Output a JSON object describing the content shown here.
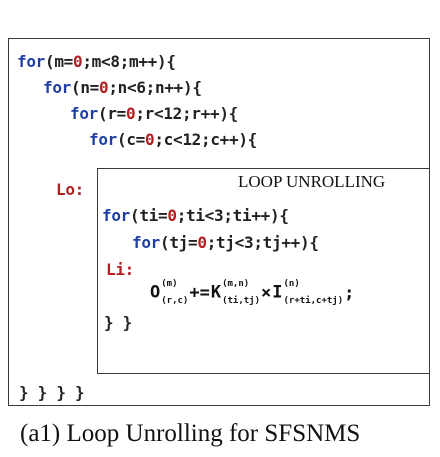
{
  "code": {
    "loop_m": {
      "kw": "for",
      "open": "(m=",
      "init": "0",
      "rest": ";m<8;m++){"
    },
    "loop_n": {
      "kw": "for",
      "open": "(n=",
      "init": "0",
      "rest": ";n<6;n++){"
    },
    "loop_r": {
      "kw": "for",
      "open": "(r=",
      "init": "0",
      "rest": ";r<12;r++){"
    },
    "loop_c": {
      "kw": "for",
      "open": "(c=",
      "init": "0",
      "rest": ";c<12;c++){"
    },
    "label_lo": "Lo:",
    "loop_ti": {
      "kw": "for",
      "open": "(ti=",
      "init": "0",
      "rest": ";ti<3;ti++){"
    },
    "loop_tj": {
      "kw": "for",
      "open": "(tj=",
      "init": "0",
      "rest": ";tj<3;tj++){"
    },
    "label_li": "Li:",
    "inner_close": "} }",
    "outer_close": "} } } }"
  },
  "equation": {
    "lhs": "O",
    "lhs_sup": "(m)",
    "lhs_sub": "(r,c)",
    "op": "+=",
    "kernel": "K",
    "kernel_sup": "(m,n)",
    "kernel_sub": "(ti,tj)",
    "times": "×",
    "input": "I",
    "input_sup": "(n)",
    "input_sub": "(r+ti,c+tj)",
    "end": ";"
  },
  "box_title": "LOOP UNROLLING",
  "caption": "(a1) Loop Unrolling for SFSNMS",
  "colors": {
    "keyword": "#1f3ea3",
    "number": "#b22020",
    "label": "#b22020",
    "text": "#222222"
  }
}
